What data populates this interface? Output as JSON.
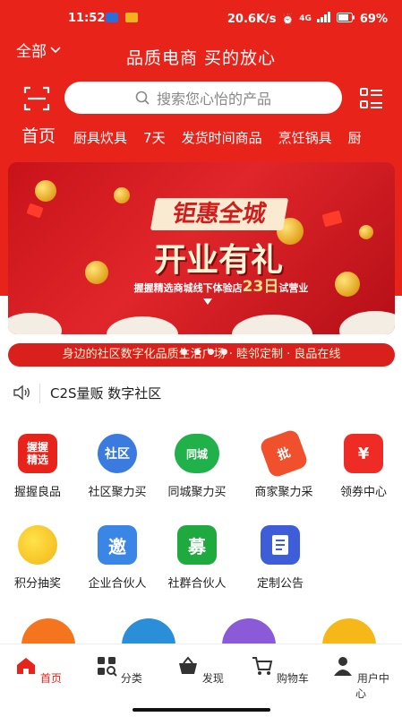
{
  "status_bar": {
    "time": "11:52",
    "speed": "20.6K/s",
    "network": "4G",
    "battery": "69%"
  },
  "header": {
    "region": "全部",
    "slogan": "品质电商 买的放心",
    "search_placeholder": "搜索您心怡的产品"
  },
  "tabs": [
    "首页",
    "厨具炊具",
    "7天",
    "发货时间商品",
    "烹饪锅具",
    "厨"
  ],
  "banner": {
    "title1": "钜惠全城",
    "title2": "开业有礼",
    "sub_prefix": "握握精选商城线下体验店",
    "sub_date": "23日",
    "sub_suffix": "试营业",
    "ticker": "身边的社区数字化品质生活广场 · 睦邻定制 · 良品在线"
  },
  "notice": "C2S量贩 数字社区",
  "grid": [
    {
      "label": "握握良品",
      "icon_text": "握握\n精选",
      "icon": "woowo-select-icon",
      "color": "#e8231a"
    },
    {
      "label": "社区聚力买",
      "icon_text": "社区",
      "icon": "community-clock-icon",
      "color": "#3b7be0"
    },
    {
      "label": "同城聚力买",
      "icon_text": "同城",
      "icon": "same-city-cloud-icon",
      "color": "#21b14a"
    },
    {
      "label": "商家聚力采",
      "icon_text": "批",
      "icon": "wholesale-icon",
      "color": "#f0502c"
    },
    {
      "label": "领券中心",
      "icon_text": "¥",
      "icon": "coupon-icon",
      "color": "#ee2b24"
    },
    {
      "label": "积分抽奖",
      "icon_text": "",
      "icon": "piggy-bank-icon",
      "color": "#f6c21c"
    },
    {
      "label": "企业合伙人",
      "icon_text": "邀",
      "icon": "invite-icon",
      "color": "#3a86e6"
    },
    {
      "label": "社群合伙人",
      "icon_text": "募",
      "icon": "recruit-icon",
      "color": "#1eaa3e"
    },
    {
      "label": "定制公告",
      "icon_text": "",
      "icon": "announcement-icon",
      "color": "#3d5ed8"
    }
  ],
  "bottom_nav": [
    {
      "label": "首页",
      "icon": "home-icon"
    },
    {
      "label": "分类",
      "icon": "category-icon"
    },
    {
      "label": "发现",
      "icon": "basket-icon"
    },
    {
      "label": "购物车",
      "icon": "cart-icon"
    },
    {
      "label": "用户中心",
      "icon": "user-icon"
    }
  ],
  "colors": {
    "brand_red": "#e8231a",
    "active_nav": "#e8231a"
  }
}
